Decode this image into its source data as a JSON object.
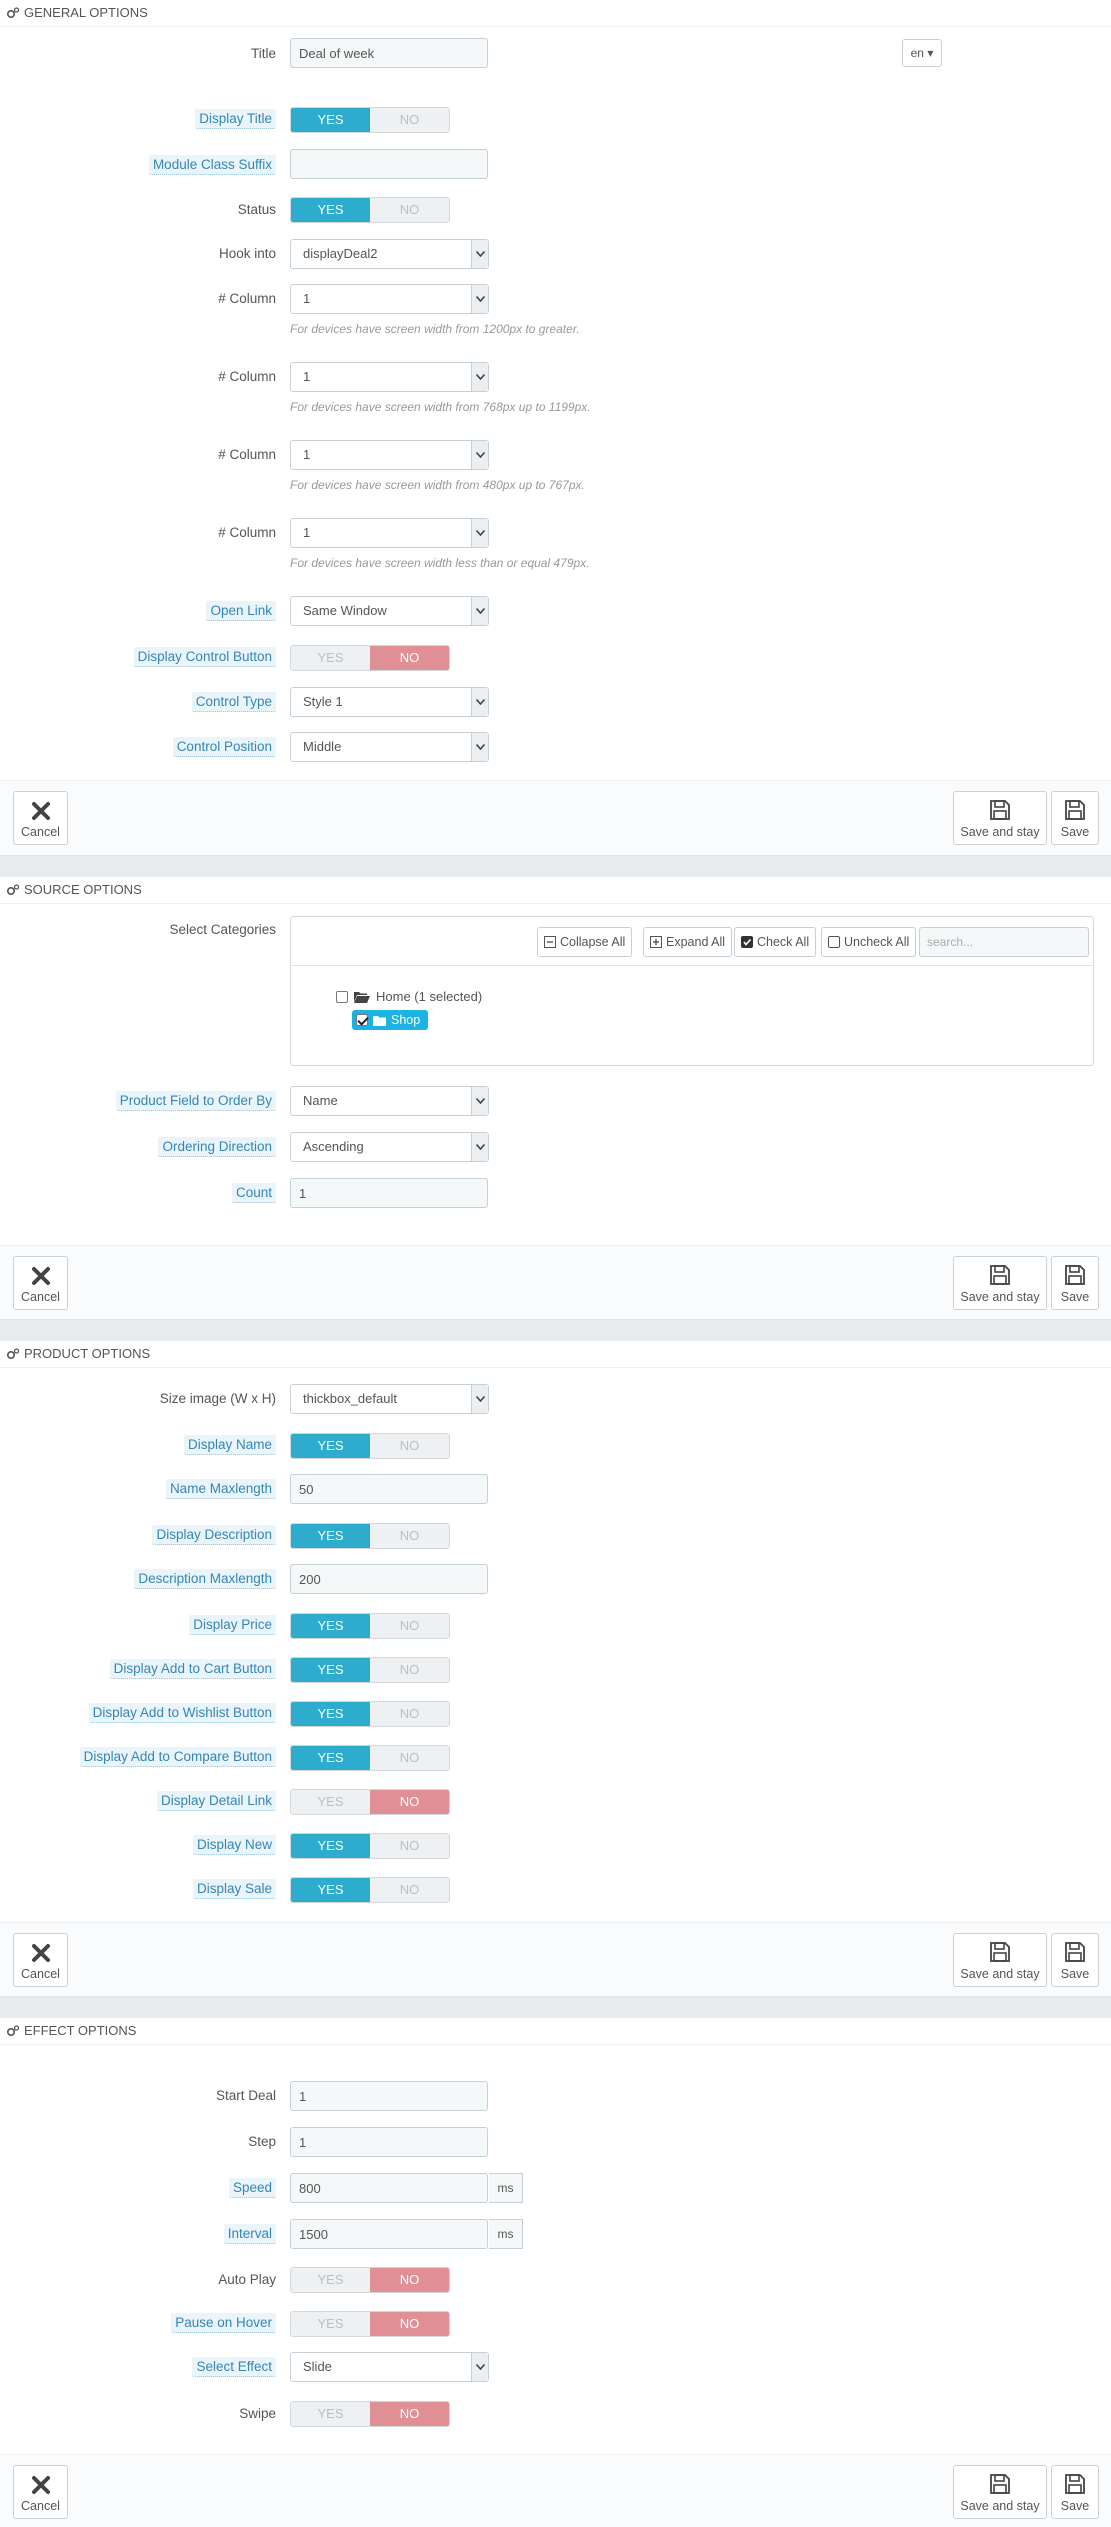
{
  "general": {
    "heading": "GENERAL OPTIONS",
    "title_label": "Title",
    "title_value": "Deal of week",
    "lang": "en",
    "display_title_label": "Display Title",
    "suffix_label": "Module Class Suffix",
    "suffix_value": "",
    "status_label": "Status",
    "hook_label": "Hook into",
    "hook_value": "displayDeal2",
    "column_label": "# Column",
    "col1_value": "1",
    "col1_help": "For devices have screen width from 1200px to greater.",
    "col2_value": "1",
    "col2_help": "For devices have screen width from 768px up to 1199px.",
    "col3_value": "1",
    "col3_help": "For devices have screen width from 480px up to 767px.",
    "col4_value": "1",
    "col4_help": "For devices have screen width less than or equal 479px.",
    "open_link_label": "Open Link",
    "open_link_value": "Same Window",
    "control_button_label": "Display Control Button",
    "control_type_label": "Control Type",
    "control_type_value": "Style 1",
    "control_position_label": "Control Position",
    "control_position_value": "Middle"
  },
  "source": {
    "heading": "SOURCE OPTIONS",
    "categories_label": "Select Categories",
    "collapse_all": "Collapse All",
    "expand_all": "Expand All",
    "check_all": "Check All",
    "uncheck_all": "Uncheck All",
    "search_placeholder": "search...",
    "home_label": "Home (1 selected)",
    "shop_label": "Shop",
    "order_by_label": "Product Field to Order By",
    "order_by_value": "Name",
    "direction_label": "Ordering Direction",
    "direction_value": "Ascending",
    "count_label": "Count",
    "count_value": "1"
  },
  "product": {
    "heading": "PRODUCT OPTIONS",
    "size_label": "Size image (W x H)",
    "size_value": "thickbox_default",
    "display_name_label": "Display Name",
    "name_max_label": "Name Maxlength",
    "name_max_value": "50",
    "display_desc_label": "Display Description",
    "desc_max_label": "Description Maxlength",
    "desc_max_value": "200",
    "display_price_label": "Display Price",
    "add_cart_label": "Display Add to Cart Button",
    "add_wishlist_label": "Display Add to Wishlist Button",
    "add_compare_label": "Display Add to Compare Button",
    "detail_link_label": "Display Detail Link",
    "display_new_label": "Display New",
    "display_sale_label": "Display Sale"
  },
  "effect": {
    "heading": "EFFECT OPTIONS",
    "start_label": "Start Deal",
    "start_value": "1",
    "step_label": "Step",
    "step_value": "1",
    "speed_label": "Speed",
    "speed_value": "800",
    "interval_label": "Interval",
    "interval_value": "1500",
    "unit": "ms",
    "autoplay_label": "Auto Play",
    "pause_label": "Pause on Hover",
    "select_effect_label": "Select Effect",
    "select_effect_value": "Slide",
    "swipe_label": "Swipe"
  },
  "toggle": {
    "yes": "YES",
    "no": "NO"
  },
  "buttons": {
    "cancel": "Cancel",
    "save_stay": "Save and stay",
    "save": "Save"
  },
  "colors": {
    "yes_on": "#2eacce",
    "no_on": "#e08f95",
    "label_highlight": "#eaf4fb"
  }
}
